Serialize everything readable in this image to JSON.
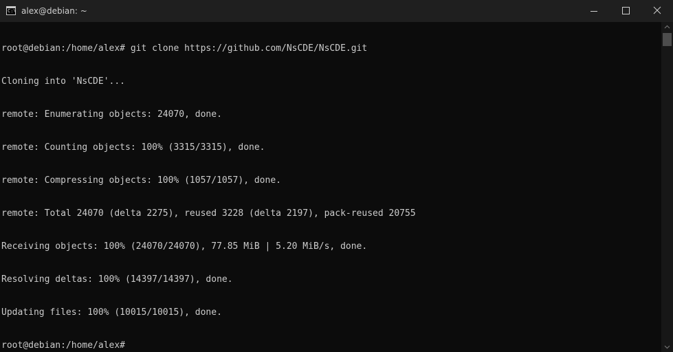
{
  "window": {
    "title": "alex@debian: ~",
    "icon": "console-icon",
    "icon_glyph": "C:\\",
    "controls": {
      "minimize": "minimize-icon",
      "maximize": "maximize-icon",
      "close": "close-icon"
    }
  },
  "terminal": {
    "lines": [
      "root@debian:/home/alex# git clone https://github.com/NsCDE/NsCDE.git",
      "Cloning into 'NsCDE'...",
      "remote: Enumerating objects: 24070, done.",
      "remote: Counting objects: 100% (3315/3315), done.",
      "remote: Compressing objects: 100% (1057/1057), done.",
      "remote: Total 24070 (delta 2275), reused 3228 (delta 2197), pack-reused 20755",
      "Receiving objects: 100% (24070/24070), 77.85 MiB | 5.20 MiB/s, done.",
      "Resolving deltas: 100% (14397/14397), done.",
      "Updating files: 100% (10015/10015), done.",
      "root@debian:/home/alex#"
    ]
  },
  "colors": {
    "background": "#0c0c0c",
    "foreground": "#cccccc",
    "titlebar": "#1f1f1f"
  }
}
